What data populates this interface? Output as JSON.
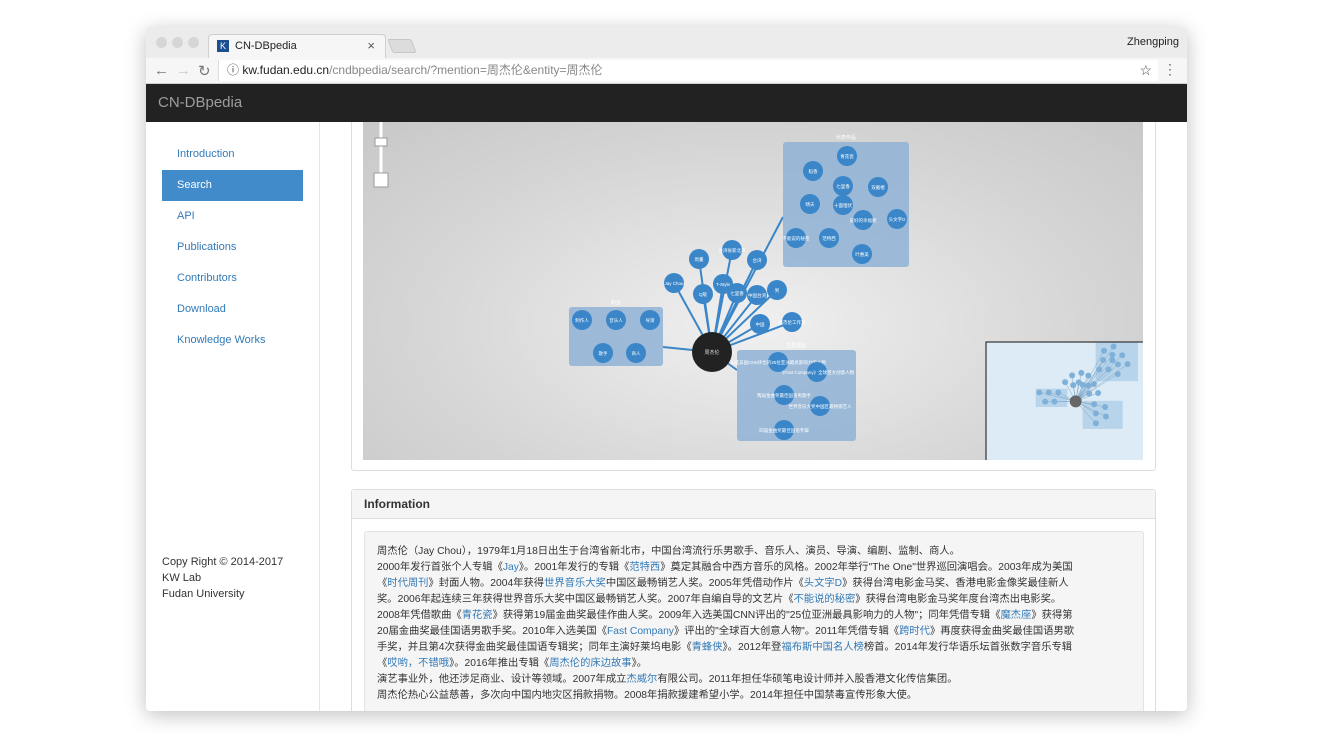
{
  "browser": {
    "tab_title": "CN-DBpedia",
    "favicon": "K",
    "user": "Zhengping",
    "url_host": "kw.fudan.edu.cn",
    "url_path": "/cndbpedia/search/?mention=周杰伦&entity=周杰伦"
  },
  "navbar": {
    "brand": "CN-DBpedia"
  },
  "sidebar": {
    "items": [
      {
        "label": "Introduction"
      },
      {
        "label": "Search"
      },
      {
        "label": "API"
      },
      {
        "label": "Publications"
      },
      {
        "label": "Contributors"
      },
      {
        "label": "Download"
      },
      {
        "label": "Knowledge Works"
      }
    ],
    "footer": [
      "Copy Right © 2014-2017",
      "KW Lab",
      "Fudan University"
    ]
  },
  "graph": {
    "center": "周杰伦",
    "groups": [
      {
        "label": "职业"
      },
      {
        "label": "代表作品"
      },
      {
        "label": "主要成就"
      }
    ],
    "nodes": [
      "Jay Chou",
      "Q版",
      "周董",
      "台湾省新北市",
      "台湾",
      "T-Style",
      "七里香",
      "中国台湾",
      "男",
      "中国",
      "周杰伦工作室"
    ],
    "group_nodes": [
      [
        "制作人",
        "音乐人",
        "导演",
        "歌手",
        "商人"
      ],
      [
        "青花瓷",
        "稻香",
        "七里香",
        "双截棍",
        "晴天",
        "十面埋伏",
        "说好的幸福呢",
        "头文字D",
        "不能说的秘密",
        "范特西",
        "叶惠美"
      ],
      [
        "入选美国CNN评出的25位亚洲最具影响力的人物",
        "《Fast Company》全球百大创意人物",
        "两届金曲奖最佳国语男歌手",
        "世界音乐大奖中国区最畅销艺人",
        "四届金曲奖最佳国语专辑"
      ]
    ]
  },
  "information": {
    "title": "Information",
    "lines": [
      [
        [
          "周杰伦（Jay Chou），1979年1月18日出生于台湾省新北市，中国台湾流行乐男歌手、音乐人、演员、导演、编剧、监制、商人。",
          0
        ]
      ],
      [
        [
          "2000年发行首张个人专辑《",
          0
        ],
        [
          "Jay",
          1
        ],
        [
          "》。2001年发行的专辑《",
          0
        ],
        [
          "范特西",
          1
        ],
        [
          "》奠定其融合中西方音乐的风格。2002年举行\"The One\"世界巡回演唱会。2003年成为美国",
          0
        ]
      ],
      [
        [
          "《",
          0
        ],
        [
          "时代周刊",
          1
        ],
        [
          "》封面人物。2004年获得",
          0
        ],
        [
          "世界音乐大奖",
          1
        ],
        [
          "中国区最畅销艺人奖。2005年凭借动作片《",
          0
        ],
        [
          "头文字D",
          1
        ],
        [
          "》获得台湾电影金马奖、香港电影金像奖最佳新人",
          0
        ]
      ],
      [
        [
          "奖。2006年起连续三年获得世界音乐大奖中国区最畅销艺人奖。2007年自编自导的文艺片《",
          0
        ],
        [
          "不能说的秘密",
          1
        ],
        [
          "》获得台湾电影金马奖年度台湾杰出电影奖。",
          0
        ]
      ],
      [
        [
          "2008年凭借歌曲《",
          0
        ],
        [
          "青花瓷",
          1
        ],
        [
          "》获得第19届金曲奖最佳作曲人奖。2009年入选美国CNN评出的\"25位亚洲最具影响力的人物\"；同年凭借专辑《",
          0
        ],
        [
          "魔杰座",
          1
        ],
        [
          "》获得第",
          0
        ]
      ],
      [
        [
          "20届金曲奖最佳国语男歌手奖。2010年入选美国《",
          0
        ],
        [
          "Fast Company",
          1
        ],
        [
          "》评出的\"全球百大创意人物\"。2011年凭借专辑《",
          0
        ],
        [
          "跨时代",
          1
        ],
        [
          "》再度获得金曲奖最佳国语男歌",
          0
        ]
      ],
      [
        [
          "手奖，并且第4次获得金曲奖最佳国语专辑奖；同年主演好莱坞电影《",
          0
        ],
        [
          "青蜂侠",
          1
        ],
        [
          "》。2012年登",
          0
        ],
        [
          "福布斯中国名人榜",
          1
        ],
        [
          "榜首。2014年发行华语乐坛首张数字音乐专辑",
          0
        ]
      ],
      [
        [
          "《",
          0
        ],
        [
          "哎哟，不错哦",
          1
        ],
        [
          "》。2016年推出专辑《",
          0
        ],
        [
          "周杰伦的床边故事",
          1
        ],
        [
          "》。",
          0
        ]
      ],
      [
        [
          "演艺事业外，他还涉足商业、设计等领域。2007年成立",
          0
        ],
        [
          "杰威尔",
          1
        ],
        [
          "有限公司。2011年担任华硕笔电设计师并入股香港文化传信集团。",
          0
        ]
      ],
      [
        [
          "周杰伦热心公益慈善，多次向中国内地灾区捐款捐物。2008年捐款援建希望小学。2014年担任中国禁毒宣传形象大使。",
          0
        ]
      ]
    ]
  },
  "colors": {
    "node": "#3a86c8",
    "group": "#8fb3d6",
    "center": "#222222",
    "navbar": "#222222",
    "active": "#428bca"
  }
}
